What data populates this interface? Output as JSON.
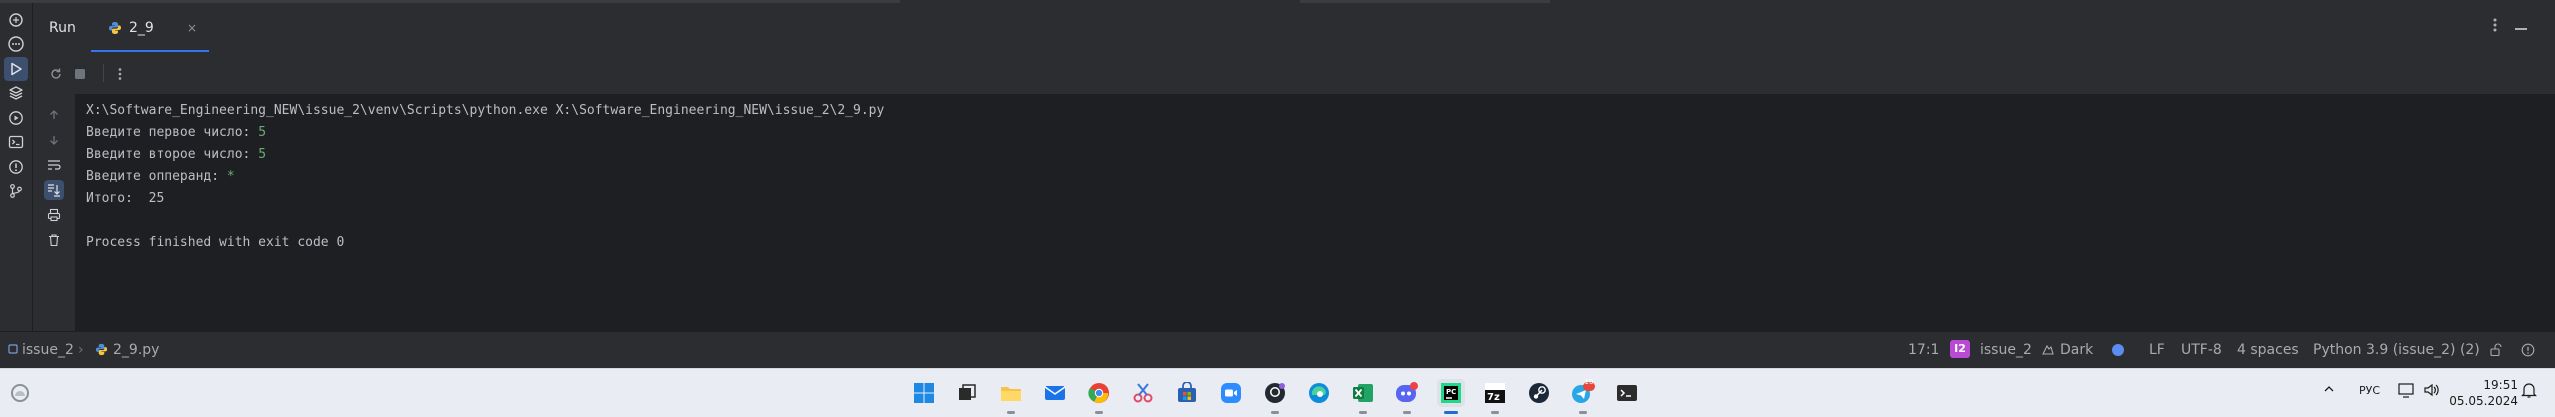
{
  "tool_window": {
    "title": "Run",
    "tab_label": "2_9",
    "tab_close": "×"
  },
  "console": {
    "lines": [
      {
        "prompt": "X:\\Software_Engineering_NEW\\issue_2\\venv\\Scripts\\python.exe X:\\Software_Engineering_NEW\\issue_2\\2_9.py",
        "input": ""
      },
      {
        "prompt": "Введите первое число: ",
        "input": "5"
      },
      {
        "prompt": "Введите второе число: ",
        "input": "5"
      },
      {
        "prompt": "Введите опперанд: ",
        "input": "*"
      },
      {
        "prompt": "Итого:  25",
        "input": ""
      },
      {
        "prompt": "",
        "input": ""
      },
      {
        "prompt": "Process finished with exit code 0",
        "input": ""
      }
    ]
  },
  "status_bar": {
    "breadcrumb_project": "issue_2",
    "breadcrumb_sep": "›",
    "breadcrumb_file": "2_9.py",
    "cursor": "17:1",
    "project_badge": "I2",
    "project_name": "issue_2",
    "theme": "Dark",
    "line_ending": "LF",
    "encoding": "UTF-8",
    "indent": "4 spaces",
    "interpreter": "Python 3.9 (issue_2) (2)"
  },
  "taskbar": {
    "language": "РУС",
    "time": "19:51",
    "date": "05.05.2024",
    "badge_count": "10",
    "app_icons": [
      "windows-start-icon",
      "task-view-icon",
      "file-explorer-icon",
      "mail-icon",
      "chrome-icon",
      "snipping-tool-icon",
      "microsoft-store-icon",
      "zoom-icon",
      "github-desktop-icon",
      "edge-icon",
      "excel-icon",
      "discord-icon",
      "pycharm-icon",
      "7zip-icon",
      "steam-icon",
      "telegram-icon",
      "terminal-icon"
    ]
  },
  "colors": {
    "accent": "#3574f0",
    "console_input": "#6aab73",
    "panel_bg": "#2b2d30",
    "console_bg": "#1e1f22"
  }
}
